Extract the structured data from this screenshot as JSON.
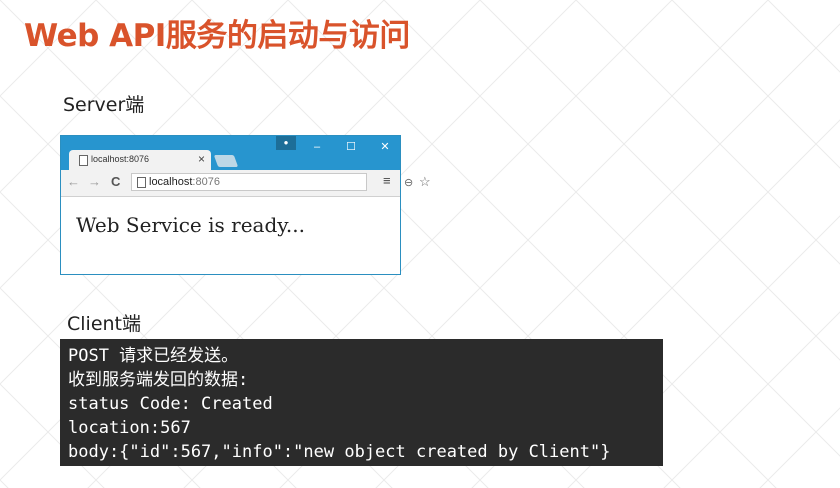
{
  "slide": {
    "title": "Web API服务的启动与访问",
    "server_label": "Server端",
    "client_label": "Client端"
  },
  "browser": {
    "tab_title": "localhost:8076",
    "tab_close": "×",
    "profile_icon": "person-icon",
    "window_controls": {
      "minimize": "–",
      "maximize": "☐",
      "close": "✕"
    },
    "nav": {
      "back": "←",
      "forward": "→",
      "reload": "C"
    },
    "url_host": "localhost",
    "url_port": ":8076",
    "zoom_icon": "⊖",
    "star_icon": "☆",
    "menu_icon": "≡",
    "page_text": "Web Service is ready..."
  },
  "console": {
    "lines": [
      "POST 请求已经发送。",
      "收到服务端发回的数据:",
      "status Code: Created",
      "location:567",
      "body:{\"id\":567,\"info\":\"new object created by Client\"}"
    ]
  },
  "colors": {
    "title": "#d9532b",
    "titlebar": "#2795cf",
    "console_bg": "#2b2b2b"
  }
}
